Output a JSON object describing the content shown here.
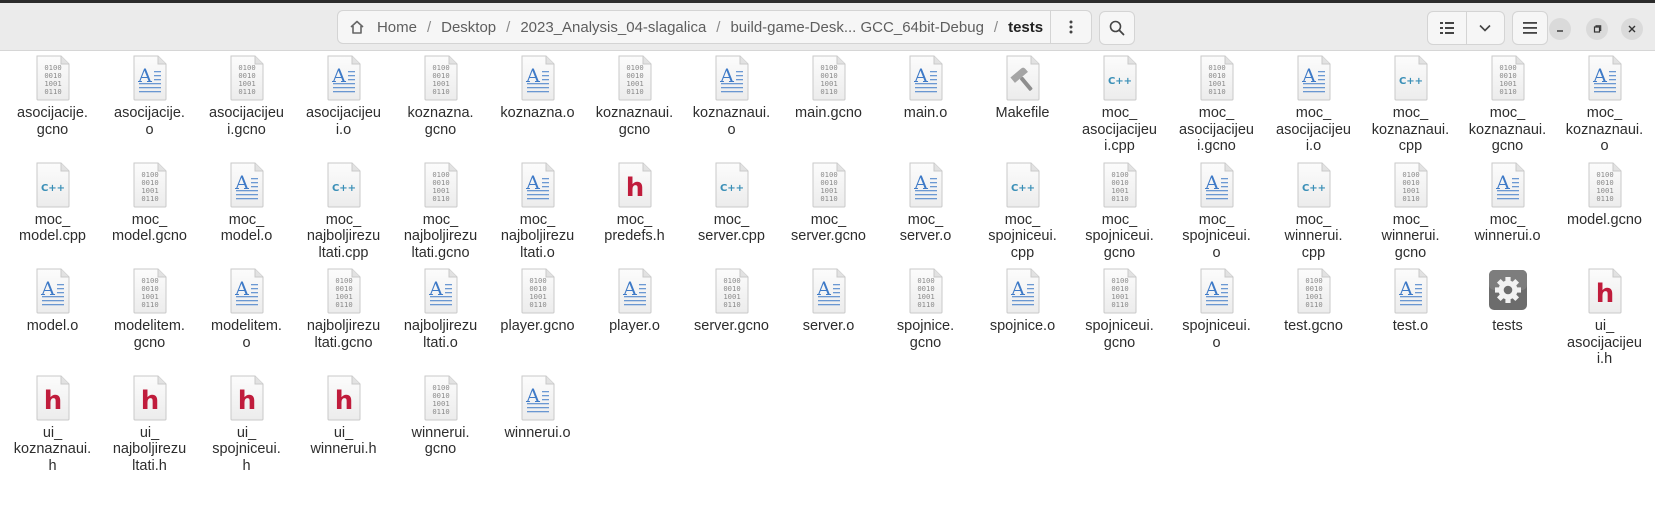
{
  "breadcrumb": {
    "items": [
      {
        "label": "Home"
      },
      {
        "label": "Desktop"
      },
      {
        "label": "2023_Analysis_04-slagalica"
      },
      {
        "label": "build-game-Desk... GCC_64bit-Debug"
      },
      {
        "label": "tests"
      }
    ],
    "separator": "/"
  },
  "colors": {
    "cpp_accent": "#3a8fb7",
    "header_h_accent": "#c01c3c",
    "object_accent": "#3e7ac7"
  },
  "files": [
    {
      "name": "asocijacije.gcno",
      "type": "gcno",
      "label": [
        "asocijacije.",
        "gcno"
      ]
    },
    {
      "name": "asocijacije.o",
      "type": "obj",
      "label": [
        "asocijacije.",
        "o"
      ]
    },
    {
      "name": "asocijacijeui.gcno",
      "type": "gcno",
      "label": [
        "asocijacijeu",
        "i.gcno"
      ]
    },
    {
      "name": "asocijacijeui.o",
      "type": "obj",
      "label": [
        "asocijacijeu",
        "i.o"
      ]
    },
    {
      "name": "koznazna.gcno",
      "type": "gcno",
      "label": [
        "koznazna.",
        "gcno"
      ]
    },
    {
      "name": "koznazna.o",
      "type": "obj",
      "label": [
        "koznazna.o"
      ]
    },
    {
      "name": "koznaznaui.gcno",
      "type": "gcno",
      "label": [
        "koznaznaui.",
        "gcno"
      ]
    },
    {
      "name": "koznaznaui.o",
      "type": "obj",
      "label": [
        "koznaznaui.",
        "o"
      ]
    },
    {
      "name": "main.gcno",
      "type": "gcno",
      "label": [
        "main.gcno"
      ]
    },
    {
      "name": "main.o",
      "type": "obj",
      "label": [
        "main.o"
      ]
    },
    {
      "name": "Makefile",
      "type": "make",
      "label": [
        "Makefile"
      ]
    },
    {
      "name": "moc_asocijacijeui.cpp",
      "type": "cpp",
      "label": [
        "moc_",
        "asocijacijeu",
        "i.cpp"
      ]
    },
    {
      "name": "moc_asocijacijeui.gcno",
      "type": "gcno",
      "label": [
        "moc_",
        "asocijacijeu",
        "i.gcno"
      ]
    },
    {
      "name": "moc_asocijacijeui.o",
      "type": "obj",
      "label": [
        "moc_",
        "asocijacijeu",
        "i.o"
      ]
    },
    {
      "name": "moc_koznaznaui.cpp",
      "type": "cpp",
      "label": [
        "moc_",
        "koznaznaui.",
        "cpp"
      ]
    },
    {
      "name": "moc_koznaznaui.gcno",
      "type": "gcno",
      "label": [
        "moc_",
        "koznaznaui.",
        "gcno"
      ]
    },
    {
      "name": "moc_koznaznaui.o",
      "type": "obj",
      "label": [
        "moc_",
        "koznaznaui.",
        "o"
      ]
    },
    {
      "name": "moc_model.cpp",
      "type": "cpp",
      "label": [
        "moc_",
        "model.cpp"
      ]
    },
    {
      "name": "moc_model.gcno",
      "type": "gcno",
      "label": [
        "moc_",
        "model.gcno"
      ]
    },
    {
      "name": "moc_model.o",
      "type": "obj",
      "label": [
        "moc_",
        "model.o"
      ]
    },
    {
      "name": "moc_najboljirezultati.cpp",
      "type": "cpp",
      "label": [
        "moc_",
        "najboljirezu",
        "ltati.cpp"
      ]
    },
    {
      "name": "moc_najboljirezultati.gcno",
      "type": "gcno",
      "label": [
        "moc_",
        "najboljirezu",
        "ltati.gcno"
      ]
    },
    {
      "name": "moc_najboljirezultati.o",
      "type": "obj",
      "label": [
        "moc_",
        "najboljirezu",
        "ltati.o"
      ]
    },
    {
      "name": "moc_predefs.h",
      "type": "h",
      "label": [
        "moc_",
        "predefs.h"
      ]
    },
    {
      "name": "moc_server.cpp",
      "type": "cpp",
      "label": [
        "moc_",
        "server.cpp"
      ]
    },
    {
      "name": "moc_server.gcno",
      "type": "gcno",
      "label": [
        "moc_",
        "server.gcno"
      ]
    },
    {
      "name": "moc_server.o",
      "type": "obj",
      "label": [
        "moc_",
        "server.o"
      ]
    },
    {
      "name": "moc_spojniceui.cpp",
      "type": "cpp",
      "label": [
        "moc_",
        "spojniceui.",
        "cpp"
      ]
    },
    {
      "name": "moc_spojniceui.gcno",
      "type": "gcno",
      "label": [
        "moc_",
        "spojniceui.",
        "gcno"
      ]
    },
    {
      "name": "moc_spojniceui.o",
      "type": "obj",
      "label": [
        "moc_",
        "spojniceui.",
        "o"
      ]
    },
    {
      "name": "moc_winnerui.cpp",
      "type": "cpp",
      "label": [
        "moc_",
        "winnerui.",
        "cpp"
      ]
    },
    {
      "name": "moc_winnerui.gcno",
      "type": "gcno",
      "label": [
        "moc_",
        "winnerui.",
        "gcno"
      ]
    },
    {
      "name": "moc_winnerui.o",
      "type": "obj",
      "label": [
        "moc_",
        "winnerui.o"
      ]
    },
    {
      "name": "model.gcno",
      "type": "gcno",
      "label": [
        "model.gcno"
      ]
    },
    {
      "name": "model.o",
      "type": "obj",
      "label": [
        "model.o"
      ]
    },
    {
      "name": "modelitem.gcno",
      "type": "gcno",
      "label": [
        "modelitem.",
        "gcno"
      ]
    },
    {
      "name": "modelitem.o",
      "type": "obj",
      "label": [
        "modelitem.",
        "o"
      ]
    },
    {
      "name": "najboljirezultati.gcno",
      "type": "gcno",
      "label": [
        "najboljirezu",
        "ltati.gcno"
      ]
    },
    {
      "name": "najboljirezultati.o",
      "type": "obj",
      "label": [
        "najboljirezu",
        "ltati.o"
      ]
    },
    {
      "name": "player.gcno",
      "type": "gcno",
      "label": [
        "player.gcno"
      ]
    },
    {
      "name": "player.o",
      "type": "obj",
      "label": [
        "player.o"
      ]
    },
    {
      "name": "server.gcno",
      "type": "gcno",
      "label": [
        "server.gcno"
      ]
    },
    {
      "name": "server.o",
      "type": "obj",
      "label": [
        "server.o"
      ]
    },
    {
      "name": "spojnice.gcno",
      "type": "gcno",
      "label": [
        "spojnice.",
        "gcno"
      ]
    },
    {
      "name": "spojnice.o",
      "type": "obj",
      "label": [
        "spojnice.o"
      ]
    },
    {
      "name": "spojniceui.gcno",
      "type": "gcno",
      "label": [
        "spojniceui.",
        "gcno"
      ]
    },
    {
      "name": "spojniceui.o",
      "type": "obj",
      "label": [
        "spojniceui.",
        "o"
      ]
    },
    {
      "name": "test.gcno",
      "type": "gcno",
      "label": [
        "test.gcno"
      ]
    },
    {
      "name": "test.o",
      "type": "obj",
      "label": [
        "test.o"
      ]
    },
    {
      "name": "tests",
      "type": "exec",
      "label": [
        "tests"
      ]
    },
    {
      "name": "ui_asocijacijeui.h",
      "type": "h",
      "label": [
        "ui_",
        "asocijacijeu",
        "i.h"
      ]
    },
    {
      "name": "ui_koznaznaui.h",
      "type": "h",
      "label": [
        "ui_",
        "koznaznaui.",
        "h"
      ]
    },
    {
      "name": "ui_najboljirezultati.h",
      "type": "h",
      "label": [
        "ui_",
        "najboljirezu",
        "ltati.h"
      ]
    },
    {
      "name": "ui_spojniceui.h",
      "type": "h",
      "label": [
        "ui_",
        "spojniceui.",
        "h"
      ]
    },
    {
      "name": "ui_winnerui.h",
      "type": "h",
      "label": [
        "ui_",
        "winnerui.h"
      ]
    },
    {
      "name": "winnerui.gcno",
      "type": "gcno",
      "label": [
        "winnerui.",
        "gcno"
      ]
    },
    {
      "name": "winnerui.o",
      "type": "obj",
      "label": [
        "winnerui.o"
      ]
    }
  ]
}
